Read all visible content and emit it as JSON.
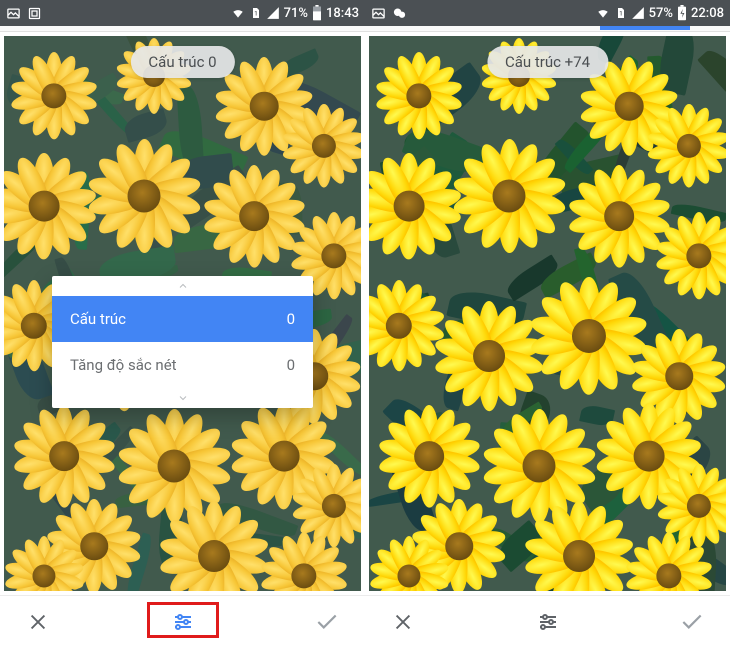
{
  "left": {
    "status": {
      "battery": "71%",
      "time": "18:43"
    },
    "pill_label": "Cấu trúc 0",
    "panel": {
      "rows": [
        {
          "label": "Cấu trúc",
          "value": "0"
        },
        {
          "label": "Tăng độ sắc nét",
          "value": "0"
        }
      ]
    }
  },
  "right": {
    "status": {
      "battery": "57%",
      "time": "22:08"
    },
    "pill_label": "Cấu trúc +74"
  }
}
